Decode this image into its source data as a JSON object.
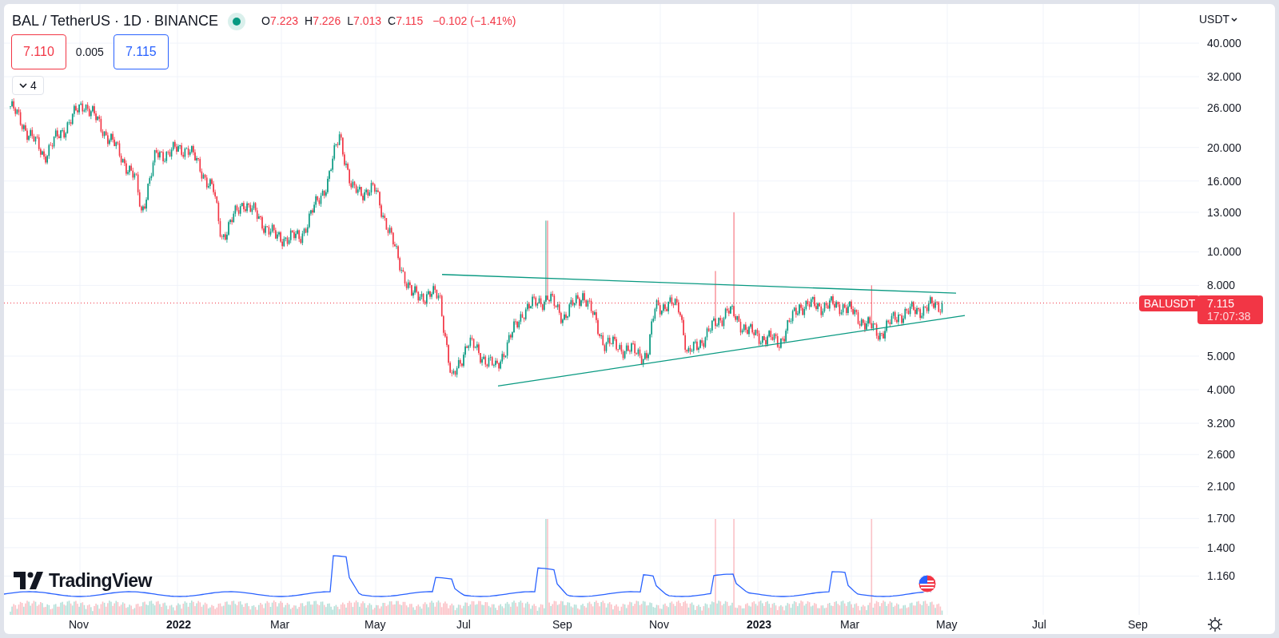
{
  "legend": {
    "symbol": "BAL / TetherUS · 1D · BINANCE",
    "market_open": true,
    "ohlc": [
      {
        "key": "O",
        "value": "7.223"
      },
      {
        "key": "H",
        "value": "7.226"
      },
      {
        "key": "L",
        "value": "7.013"
      },
      {
        "key": "C",
        "value": "7.115"
      }
    ],
    "change": "−0.102 (−1.41%)",
    "sell": "7.110",
    "spread": "0.005",
    "buy": "7.115",
    "indicators_toggle": "4"
  },
  "price_axis": {
    "currency": "USDT",
    "ticks": [
      "40.000",
      "32.000",
      "26.000",
      "20.000",
      "16.000",
      "13.000",
      "10.000",
      "8.000",
      "5.000",
      "4.000",
      "3.200",
      "2.600",
      "2.100",
      "1.700",
      "1.400",
      "1.160"
    ],
    "symbol_tag": "BALUSDT",
    "last_price": "7.115",
    "countdown": "17:07:38"
  },
  "time_axis": [
    {
      "label": "Nov",
      "kind": "month"
    },
    {
      "label": "2022",
      "kind": "year"
    },
    {
      "label": "Mar",
      "kind": "month"
    },
    {
      "label": "May",
      "kind": "month"
    },
    {
      "label": "Jul",
      "kind": "month"
    },
    {
      "label": "Sep",
      "kind": "month"
    },
    {
      "label": "Nov",
      "kind": "month"
    },
    {
      "label": "2023",
      "kind": "year"
    },
    {
      "label": "Mar",
      "kind": "month"
    },
    {
      "label": "May",
      "kind": "month"
    },
    {
      "label": "Jul",
      "kind": "month"
    },
    {
      "label": "Sep",
      "kind": "month"
    }
  ],
  "logo": "TradingView"
}
